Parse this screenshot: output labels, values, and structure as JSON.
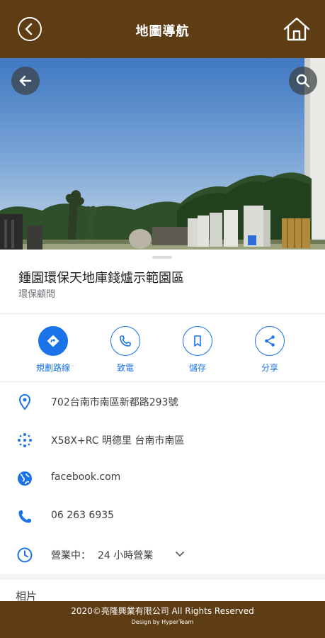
{
  "header": {
    "title": "地圖導航",
    "back_icon": "circle-chevron-left-icon",
    "home_icon": "home-icon",
    "background": "#5e3c14"
  },
  "photo": {
    "back_icon": "arrow-left-icon",
    "search_icon": "search-icon"
  },
  "place": {
    "name": "鍾園環保天地庫錢爐示範園區",
    "category": "環保顧問"
  },
  "actions": [
    {
      "label": "規劃路線",
      "icon": "directions-icon"
    },
    {
      "label": "致電",
      "icon": "phone-icon"
    },
    {
      "label": "儲存",
      "icon": "bookmark-icon"
    },
    {
      "label": "分享",
      "icon": "share-icon"
    }
  ],
  "info": {
    "address": "702台南市南區新都路293號",
    "plus_code": "X58X+RC 明德里 台南市南區",
    "website": "facebook.com",
    "phone": "06 263 6935",
    "hours_status": "營業中：",
    "hours_value": "24 小時營業"
  },
  "photos_heading": "相片",
  "footer": {
    "copyright": "2020©亮隆興業有限公司 All Rights Reserved",
    "design": "Design by HyperTeam"
  },
  "colors": {
    "accent": "#1a73e8",
    "brand_brown": "#5e3c14"
  }
}
